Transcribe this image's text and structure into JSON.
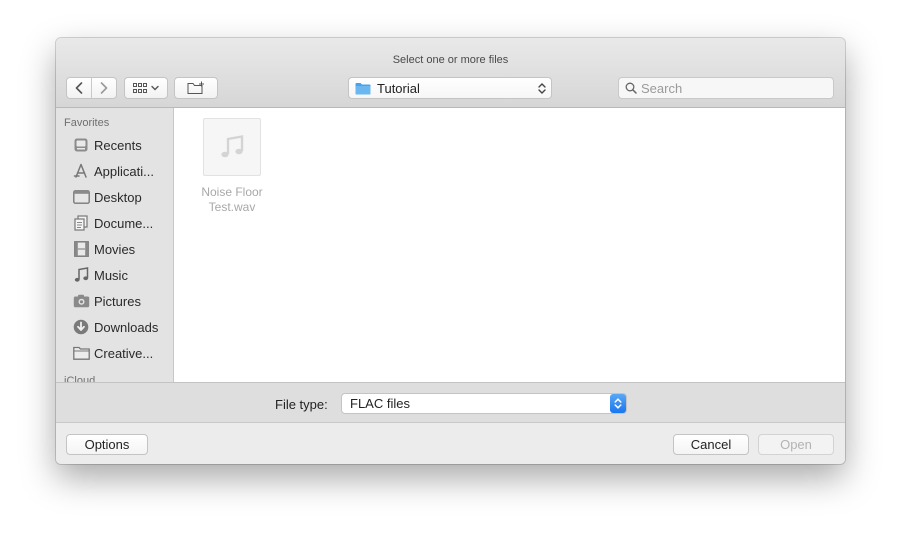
{
  "window": {
    "title": "Select one or more files"
  },
  "toolbar": {
    "back_icon": "chevron-left-icon",
    "forward_icon": "chevron-right-icon",
    "view_icon": "icon-grid-view-icon",
    "new_folder_icon": "new-folder-icon",
    "location": "Tutorial",
    "search_placeholder": "Search"
  },
  "sidebar": {
    "favorites_heading": "Favorites",
    "next_heading": "iCloud",
    "items": [
      {
        "label": "Recents",
        "icon": "recents-icon"
      },
      {
        "label": "Applicati...",
        "icon": "applications-icon"
      },
      {
        "label": "Desktop",
        "icon": "desktop-icon"
      },
      {
        "label": "Docume...",
        "icon": "documents-icon"
      },
      {
        "label": "Movies",
        "icon": "movies-icon"
      },
      {
        "label": "Music",
        "icon": "music-icon"
      },
      {
        "label": "Pictures",
        "icon": "pictures-icon"
      },
      {
        "label": "Downloads",
        "icon": "downloads-icon"
      },
      {
        "label": "Creative...",
        "icon": "folder-icon"
      }
    ]
  },
  "files": [
    {
      "name_line1": "Noise Floor",
      "name_line2": "Test.wav",
      "icon": "audio-file-icon",
      "enabled": false
    }
  ],
  "accessory": {
    "file_type_label": "File type:",
    "file_type_value": "FLAC files"
  },
  "buttons": {
    "options": "Options",
    "cancel": "Cancel",
    "open": "Open"
  },
  "colors": {
    "accent": "#1a76ee",
    "folder": "#4aa3ea"
  }
}
